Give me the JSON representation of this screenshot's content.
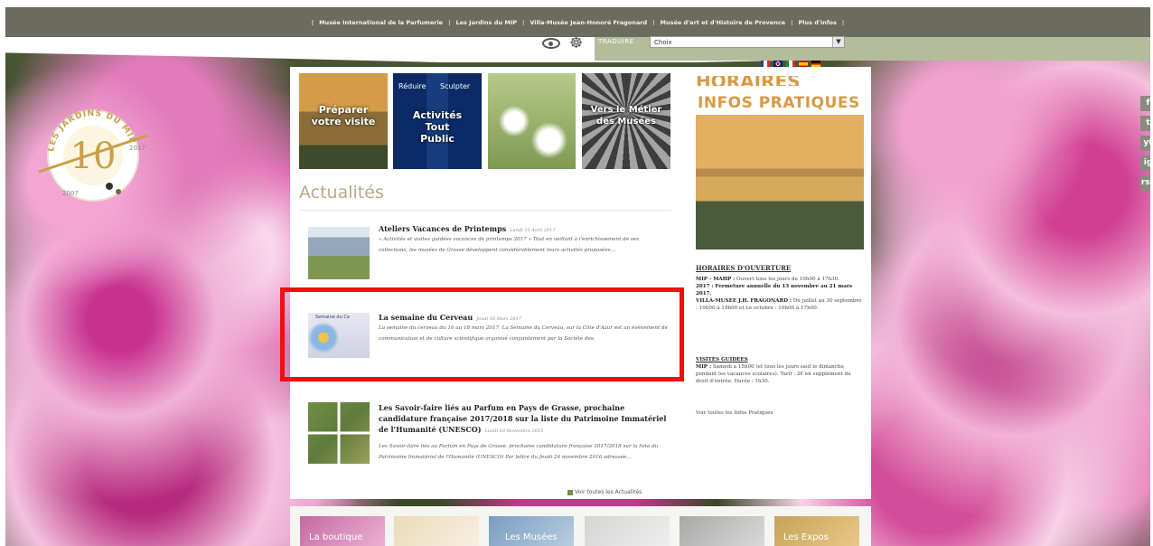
{
  "top_nav": {
    "items": [
      "Musée International de la Parfumerie",
      "Les Jardins du MIP",
      "Villa-Musée Jean-Honoré Fragonard",
      "Musée d'art et d'Histoire de Provence",
      "Plus d'infos"
    ],
    "separator": "|"
  },
  "language": {
    "label": "TRADUIRE",
    "select_value": "Choix",
    "flags": [
      "fr",
      "en",
      "it",
      "es",
      "de"
    ]
  },
  "logo": {
    "text": "LES JARDINS DU MIP",
    "number": "10",
    "years": [
      "2007",
      "2017"
    ]
  },
  "tiles": [
    {
      "name": "preparer",
      "caption": "Préparer votre visite"
    },
    {
      "name": "activites",
      "caption": "Activités Tout Public",
      "small": [
        "Réduire",
        "Sculpter"
      ]
    },
    {
      "name": "tile3",
      "caption": ""
    },
    {
      "name": "metier",
      "caption": "Vers le Métier des Musées"
    }
  ],
  "infos": {
    "horaires": "HORAIRES",
    "title": "INFOS PRATIQUES",
    "heading": "HORAIRES D'OUVERTURE",
    "blocks": [
      {
        "bold": "MIP - MAHP :",
        "text": " Ouvert tous les jours de 10h00 à 17h30."
      },
      {
        "bold": "2017 : Fermeture annuelle du 13 novembre au 21 mars 2017.",
        "text": ""
      },
      {
        "bold": "VILLA-MUSEE J.H. FRAGONARD :",
        "text": " Du juillet au 30 septembre : 10h00 à 18h00 et Le octobre : 10h00 à 17h00."
      },
      {
        "bold": "VISITES GUIDEES",
        "text": ""
      },
      {
        "bold": "MIP :",
        "text": " Samedi à 15h00 (et tous les jours sauf le dimanche pendant les vacances scolaires). Tarif : 2€ en supplément du droit d'entrée. Durée : 1h30."
      }
    ],
    "link": "Voir toutes les Infos Pratiques"
  },
  "actualites": {
    "title": "Actualités",
    "items": [
      {
        "title": "Ateliers Vacances de Printemps",
        "date": "Lundi 10 Avril 2017",
        "desc": "« Activités et visites guidées vacances de printemps 2017 » Tout en veillant à l'enrichissement de ses collections, les musées de Grasse développent considérablement leurs activités proposées..."
      },
      {
        "title": "La semaine du Cerveau",
        "date": "Jeudi 16 Mars 2017",
        "thumb_label": "Semaine du Ce",
        "desc": "La semaine du cerveau du 16 au 18 mars 2017. La Semaine du Cerveau, sur la Côte d'Azur est un événement de communication et de culture scientifique organisé conjointement par la Société des."
      },
      {
        "title": "Les Savoir-faire liés au Parfum en Pays de Grasse, prochaine candidature française 2017/2018 sur la liste du Patrimoine Immatériel de l'Humanité (UNESCO)",
        "date": "Lundi 03 Novembre 2015",
        "desc": "Les Savoir-faire liés au Parfum en Pays de Grasse, prochaine candidature française 2017/2018 sur la liste du Patrimoine Immatériel de l'Humanité (UNESCO) Par lettre du Jeudi 24 novembre 2016 adressée..."
      }
    ],
    "more_link": "Voir toutes les Actualités"
  },
  "bottom_tiles": [
    "La boutique",
    "",
    "Les Musées",
    "",
    "",
    "Les Expos"
  ],
  "social": [
    "f",
    "t",
    "yt",
    "ig",
    "rss"
  ]
}
